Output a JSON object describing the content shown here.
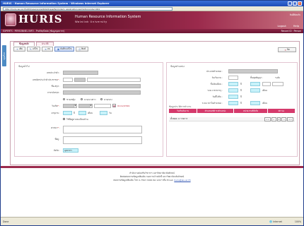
{
  "window": {
    "title": "HURIS - Human Resource Information System - Windows Internet Explorer",
    "address": "http://huris.wu.ac.th/gfutuperson/editAddress/fan/indem_application.jsp?Actioncode=001"
  },
  "banner": {
    "brand": "HURIS",
    "subtitle": "Human Resource Information System",
    "subtitle2": "Walailak University",
    "top_right": "ยินดีต้อนรับ",
    "links": {
      "logout": "Logout",
      "help": "Help"
    }
  },
  "userbar": {
    "left": "EXPERTS : PERSONNEL INFO - Profile/Data (ข้อมูลบุคลากร)",
    "right": "Record ID : Person"
  },
  "sidetab": {
    "label": "เมนูหลัก"
  },
  "tabs": [
    {
      "label": "ข้อมูลหลัก"
    },
    {
      "label": "ประวัติ"
    }
  ],
  "toolbar": {
    "add": "เพิ่ม",
    "edit": "แก้ไข",
    "delete": "ลบ",
    "save_label": "บันทึก/แก้ไข",
    "print": "พิมพ์",
    "close": "ปิด"
  },
  "left_panel": {
    "header": "ข้อมูลทั่วไป",
    "labels": {
      "personal_id": "เลขประจำตัว",
      "national_id": "เลขบัตรประจำตัวประชาชน",
      "name_th": "ชื่อ-สกุล",
      "name_en": "ภาษาอังกฤษ",
      "birth_date": "วันเกิด",
      "age": "อายุงาน",
      "religion": "ศาสนา",
      "address": "ที่อยู่",
      "section": "สังกัด"
    },
    "gender_options": [
      "ชาย/หญิง",
      "นาง/นางสาว",
      "นาย/นาง"
    ],
    "birth_date_value": "01/12/2549",
    "age_years_label": "ปี",
    "age_months_label": "เดือน",
    "age_days_label": "วัน",
    "checkbox_label": "ใช้ที่อยู่ตามทะเบียนบ้าน",
    "section_value": "บุคลากร"
  },
  "right_panel": {
    "header": "ข้อมูลตำแหน่ง",
    "labels": {
      "position": "ประเภทตำแหน่ง",
      "start": "วันเริ่มงาน",
      "end": "สิ้นสุดสัญญา",
      "level": "ระดับ",
      "step1": "ขั้นเงินเดือน",
      "step2": "ระยะเวลาบรรจุ",
      "step3": "วันที่ได้รับ",
      "step4": "ระยะเวลาในตำแหน่ง"
    },
    "unit_year": "ปี",
    "unit_month": "เดือน",
    "grid_title": "ข้อมูลประวัติการทำงาน",
    "grid_columns": [
      "วันเริ่มต้นงาน",
      "ตำแหน่งที่ดำรงตำแหน่ง",
      "หน่วยงานที่สังกัด",
      "สถานะ"
    ],
    "grid_row_label": "ทั้งหมด: 0 รายการ",
    "pager": [
      "<<",
      "<",
      "1",
      ">",
      ">>"
    ]
  },
  "footer": {
    "line1": "สำนักงานส่งเสริมวิชาการ มหาวิทยาลัยวลัยลักษณ์",
    "line2": "ติดต่อสอบถามข้อมูลเพิ่มเติม กองการเจ้าหน้าที่ มหาวิทยาลัยวลัยลักษณ์",
    "line3_prefix": "สอบถามข้อมูลเพิ่มเติม โทร 0-7567-3000 ต่อ 1207 หรือ Email:",
    "line3_link": "huris@wu.ac.th"
  },
  "statusbar": {
    "left": "Done",
    "zone": "Internet",
    "zoom": "100%"
  }
}
